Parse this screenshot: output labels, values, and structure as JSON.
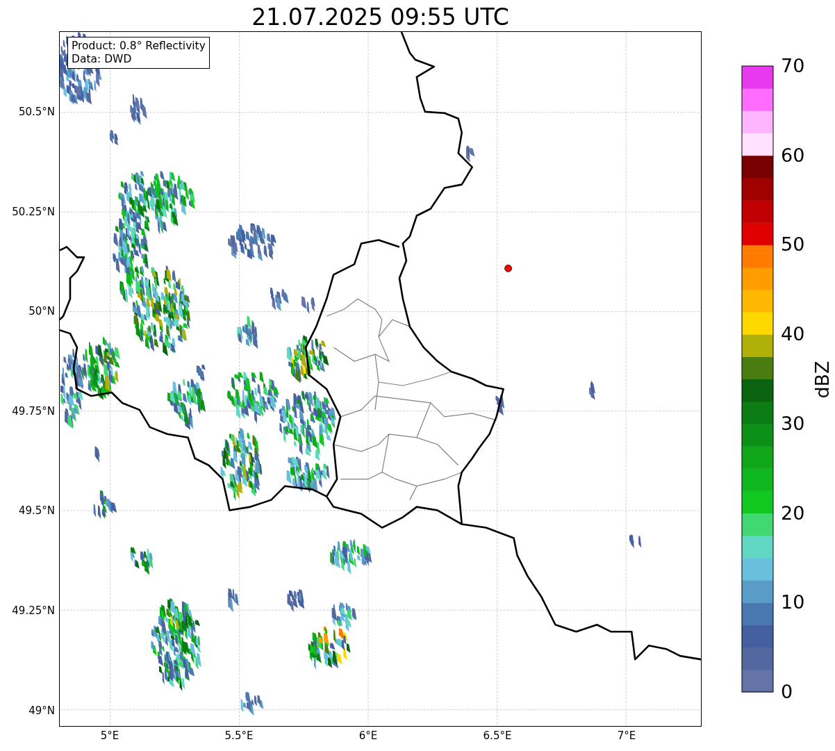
{
  "title": "21.07.2025 09:55 UTC",
  "legend": {
    "lines": [
      "Product: 0.8° Reflectivity",
      "Data: DWD"
    ]
  },
  "map": {
    "y_ticks": [
      "50.5°N",
      "50.25°N",
      "50°N",
      "49.75°N",
      "49.5°N",
      "49.25°N",
      "49°N"
    ],
    "x_ticks": [
      "5°E",
      "5.5°E",
      "6°E",
      "6.5°E",
      "7°E"
    ]
  },
  "colorbar": {
    "label": "dBZ",
    "ticks": [
      "70",
      "60",
      "50",
      "40",
      "30",
      "20",
      "10",
      "0"
    ],
    "segments": [
      {
        "color": "#6574a8"
      },
      {
        "color": "#5468a0"
      },
      {
        "color": "#4460a0"
      },
      {
        "color": "#4a78b0"
      },
      {
        "color": "#5a9cc8"
      },
      {
        "color": "#68c0dc"
      },
      {
        "color": "#60d8c4"
      },
      {
        "color": "#40d870"
      },
      {
        "color": "#10c820"
      },
      {
        "color": "#10b820"
      },
      {
        "color": "#10a818"
      },
      {
        "color": "#0c9018"
      },
      {
        "color": "#0c7c14"
      },
      {
        "color": "#0a6410"
      },
      {
        "color": "#4a7c10"
      },
      {
        "color": "#b0b008"
      },
      {
        "color": "#ffd800"
      },
      {
        "color": "#ffb800"
      },
      {
        "color": "#ff9c00"
      },
      {
        "color": "#ff7c00"
      },
      {
        "color": "#e00000"
      },
      {
        "color": "#c00000"
      },
      {
        "color": "#a00000"
      },
      {
        "color": "#780000"
      },
      {
        "color": "#ffe0ff"
      },
      {
        "color": "#ffb4ff"
      },
      {
        "color": "#ff6cff"
      },
      {
        "color": "#e838f0"
      }
    ]
  }
}
